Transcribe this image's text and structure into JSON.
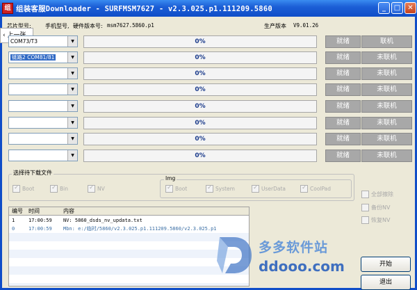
{
  "window": {
    "title": "组装客服Downloader - SURFMSM7627 - v2.3.025.p1.111209.5860",
    "min_glyph": "_",
    "max_glyph": "□",
    "close_glyph": "✕",
    "icon": "app-icon"
  },
  "info": {
    "chip_label": "芯片型号",
    "phone_label": "手机型号",
    "hw_label": "硬件版本号",
    "hw_value": "msm7627.5860.p1",
    "prod_label": "生产版本",
    "prod_value": "V9.01.26"
  },
  "overlay": {
    "prev_label": "上一张"
  },
  "channels": [
    {
      "port": "COM73/T3",
      "progress": "0%",
      "progress_value": 0,
      "status": "就绪",
      "conn": "联机",
      "selected": false
    },
    {
      "port": "链路2  COM81/81",
      "progress": "0%",
      "progress_value": 0,
      "status": "就绪",
      "conn": "未联机",
      "selected": true
    },
    {
      "port": "",
      "progress": "0%",
      "progress_value": 0,
      "status": "就绪",
      "conn": "未联机",
      "selected": false
    },
    {
      "port": "",
      "progress": "0%",
      "progress_value": 0,
      "status": "就绪",
      "conn": "未联机",
      "selected": false
    },
    {
      "port": "",
      "progress": "0%",
      "progress_value": 0,
      "status": "就绪",
      "conn": "未联机",
      "selected": false
    },
    {
      "port": "",
      "progress": "0%",
      "progress_value": 0,
      "status": "就绪",
      "conn": "未联机",
      "selected": false
    },
    {
      "port": "",
      "progress": "0%",
      "progress_value": 0,
      "status": "就绪",
      "conn": "未联机",
      "selected": false
    },
    {
      "port": "",
      "progress": "0%",
      "progress_value": 0,
      "status": "就绪",
      "conn": "未联机",
      "selected": false
    }
  ],
  "file_select": {
    "title": "选择待下载文件",
    "items": [
      {
        "label": "Boot",
        "checked": true
      },
      {
        "label": "Bin",
        "checked": true
      },
      {
        "label": "NV",
        "checked": true
      }
    ],
    "img_group": {
      "title": "Img",
      "items": [
        {
          "label": "Boot",
          "checked": true
        },
        {
          "label": "System",
          "checked": true
        },
        {
          "label": "UserData",
          "checked": true
        },
        {
          "label": "CoolPad",
          "checked": true
        }
      ]
    }
  },
  "log": {
    "columns": {
      "num": "编号",
      "time": "时间",
      "content": "内容"
    },
    "rows": [
      {
        "num": "1",
        "time": "17:00:59",
        "content": "NV: 5860_dsds_nv_updata.txt"
      },
      {
        "num": "0",
        "time": "17:00:59",
        "content": "Mbn: e:/临时/5860/v2.3.025.p1.111209.5860/v2.3.025.p1"
      }
    ]
  },
  "options": [
    {
      "label": "全部擦除",
      "checked": false
    },
    {
      "label": "备份NV",
      "checked": false
    },
    {
      "label": "恢复NV",
      "checked": false
    }
  ],
  "actions": {
    "start": "开始",
    "exit": "退出"
  },
  "watermark": {
    "cn": "多多软件站",
    "en": "ddooo.com"
  },
  "colors": {
    "titlebar": "#0f4dc8",
    "status_bg": "#a8a8a8",
    "progress_text": "#1c3c8c",
    "watermark": "#3f6fbf"
  }
}
